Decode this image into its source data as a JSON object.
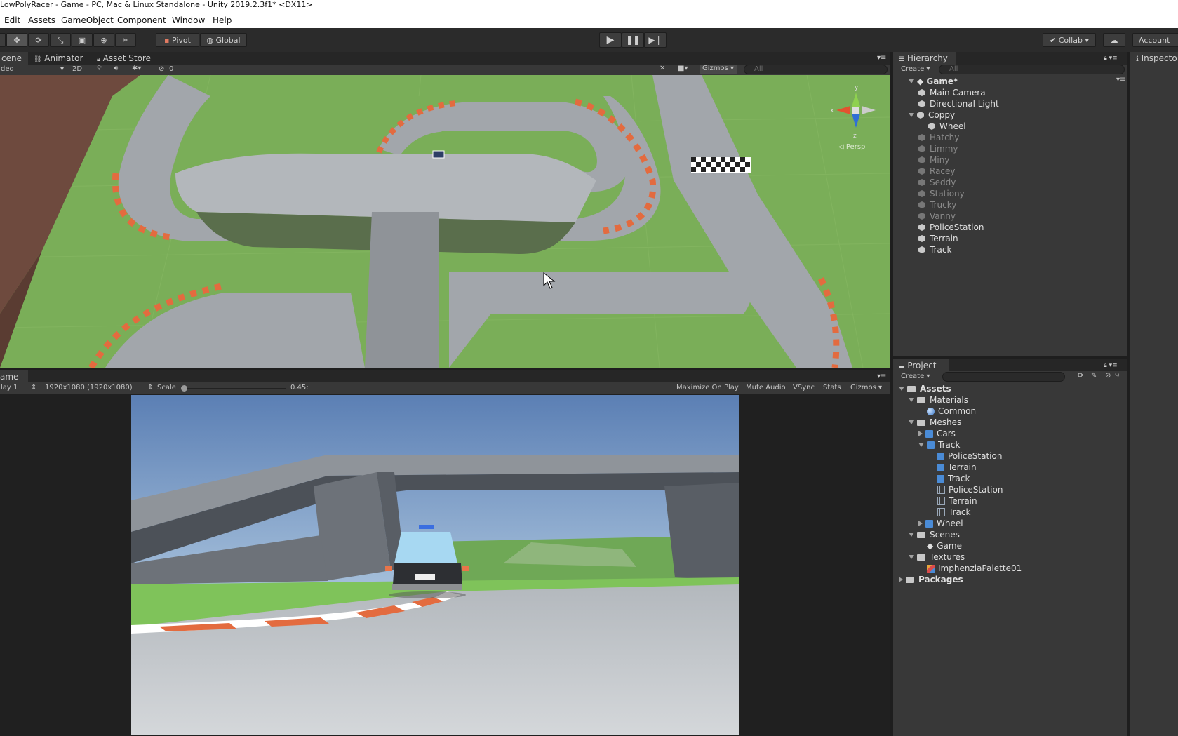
{
  "window": {
    "title": "LowPolyRacer - Game - PC, Mac & Linux Standalone - Unity 2019.2.3f1* <DX11>"
  },
  "menu": [
    "Edit",
    "Assets",
    "GameObject",
    "Component",
    "Window",
    "Help"
  ],
  "toolbar": {
    "pivot": "Pivot",
    "global": "Global",
    "collab": "Collab",
    "account": "Account"
  },
  "scene_panel": {
    "tabs": [
      "cene",
      "Animator",
      "Asset Store"
    ],
    "shading": "ded",
    "mode_2d": "2D",
    "hidden_count": "0",
    "gizmos": "Gizmos",
    "search_placeholder": "All",
    "gizmo_labels": {
      "y": "y",
      "x": "x",
      "z": "z",
      "persp": "Persp"
    }
  },
  "game_panel": {
    "tab": "ame",
    "display": "lay 1",
    "resolution": "1920x1080 (1920x1080)",
    "scale_label": "Scale",
    "scale_value": "0.45:",
    "options": [
      "Maximize On Play",
      "Mute Audio",
      "VSync",
      "Stats",
      "Gizmos"
    ]
  },
  "hierarchy": {
    "tab": "Hierarchy",
    "create": "Create",
    "search_placeholder": "All",
    "scene": "Game*",
    "items": [
      {
        "label": "Main Camera",
        "indent": 1,
        "active": true
      },
      {
        "label": "Directional Light",
        "indent": 1,
        "active": true
      },
      {
        "label": "Coppy",
        "indent": 1,
        "active": true,
        "expanded": true
      },
      {
        "label": "Wheel",
        "indent": 2,
        "active": true
      },
      {
        "label": "Hatchy",
        "indent": 1,
        "active": false
      },
      {
        "label": "Limmy",
        "indent": 1,
        "active": false
      },
      {
        "label": "Miny",
        "indent": 1,
        "active": false
      },
      {
        "label": "Racey",
        "indent": 1,
        "active": false
      },
      {
        "label": "Seddy",
        "indent": 1,
        "active": false
      },
      {
        "label": "Stationy",
        "indent": 1,
        "active": false
      },
      {
        "label": "Trucky",
        "indent": 1,
        "active": false
      },
      {
        "label": "Vanny",
        "indent": 1,
        "active": false
      },
      {
        "label": "PoliceStation",
        "indent": 1,
        "active": true
      },
      {
        "label": "Terrain",
        "indent": 1,
        "active": true
      },
      {
        "label": "Track",
        "indent": 1,
        "active": true
      }
    ]
  },
  "inspector": {
    "tab": "Inspecto"
  },
  "project": {
    "tab": "Project",
    "create": "Create",
    "hidden_count": "9",
    "tree": [
      {
        "label": "Assets",
        "indent": 0,
        "type": "folder",
        "arrow": "down",
        "bold": true
      },
      {
        "label": "Materials",
        "indent": 1,
        "type": "folder",
        "arrow": "down"
      },
      {
        "label": "Common",
        "indent": 2,
        "type": "material"
      },
      {
        "label": "Meshes",
        "indent": 1,
        "type": "folder",
        "arrow": "down"
      },
      {
        "label": "Cars",
        "indent": 2,
        "type": "mesh",
        "arrow": "right"
      },
      {
        "label": "Track",
        "indent": 2,
        "type": "mesh",
        "arrow": "down"
      },
      {
        "label": "PoliceStation",
        "indent": 3,
        "type": "mesh"
      },
      {
        "label": "Terrain",
        "indent": 3,
        "type": "mesh"
      },
      {
        "label": "Track",
        "indent": 3,
        "type": "mesh"
      },
      {
        "label": "PoliceStation",
        "indent": 3,
        "type": "grid"
      },
      {
        "label": "Terrain",
        "indent": 3,
        "type": "grid"
      },
      {
        "label": "Track",
        "indent": 3,
        "type": "grid"
      },
      {
        "label": "Wheel",
        "indent": 2,
        "type": "mesh",
        "arrow": "right"
      },
      {
        "label": "Scenes",
        "indent": 1,
        "type": "folder",
        "arrow": "down"
      },
      {
        "label": "Game",
        "indent": 2,
        "type": "scene"
      },
      {
        "label": "Textures",
        "indent": 1,
        "type": "folder",
        "arrow": "down"
      },
      {
        "label": "ImphenziaPalette01",
        "indent": 2,
        "type": "texture"
      },
      {
        "label": "Packages",
        "indent": 0,
        "type": "folder",
        "arrow": "right",
        "bold": true
      }
    ]
  },
  "colors": {
    "play_accent": "#cfcfcf",
    "grass": "#7aae58",
    "track": "#a2a6ab",
    "curb_red": "#e36b3f",
    "sky": "#5b7fb4"
  }
}
